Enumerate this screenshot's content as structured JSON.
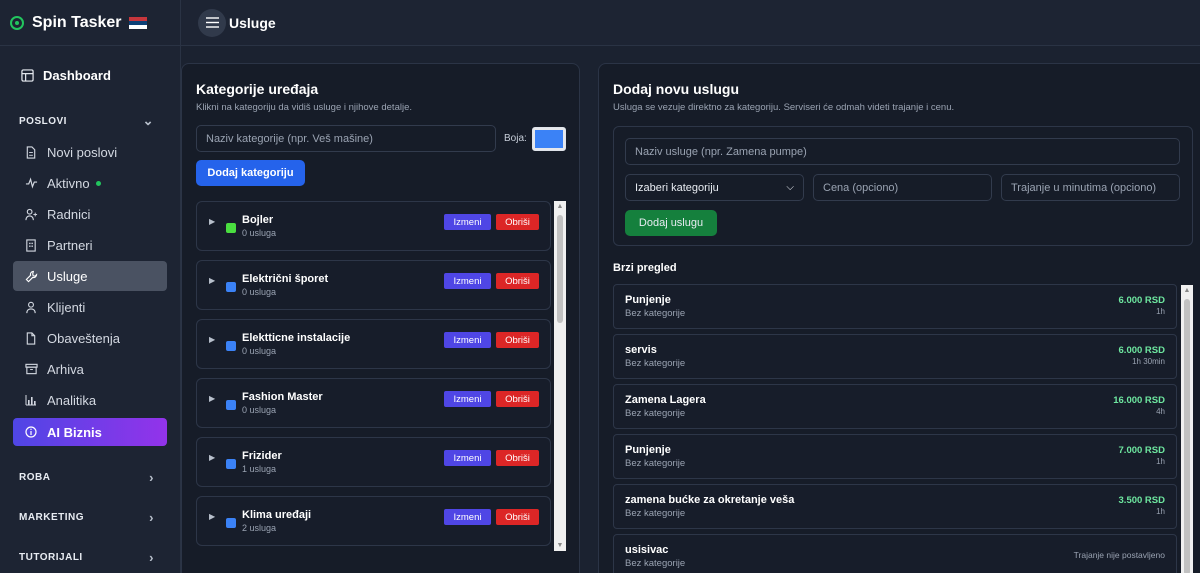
{
  "app": {
    "name": "Spin Tasker"
  },
  "topbar": {
    "title": "Usluge"
  },
  "sidebar": {
    "dashboard": "Dashboard",
    "sections": {
      "poslovi": "POSLOVI",
      "roba": "ROBA",
      "marketing": "MARKETING",
      "tutorijali": "TUTORIJALI"
    },
    "items": [
      {
        "label": "Novi poslovi",
        "icon": "document-icon"
      },
      {
        "label": "Aktivno",
        "icon": "activity-icon"
      },
      {
        "label": "Radnici",
        "icon": "user-plus-icon"
      },
      {
        "label": "Partneri",
        "icon": "building-icon"
      },
      {
        "label": "Usluge",
        "icon": "wrench-icon"
      },
      {
        "label": "Klijenti",
        "icon": "user-icon"
      },
      {
        "label": "Obaveštenja",
        "icon": "file-icon"
      },
      {
        "label": "Arhiva",
        "icon": "archive-icon"
      },
      {
        "label": "Analitika",
        "icon": "bar-chart-icon"
      }
    ],
    "ai": "AI Biznis"
  },
  "categories": {
    "title": "Kategorije uređaja",
    "subtitle": "Klikni na kategoriju da vidiš usluge i njihove detalje.",
    "input_placeholder": "Naziv kategorije (npr. Veš mašine)",
    "color_label": "Boja:",
    "color_value": "#3b82f6",
    "add_button": "Dodaj kategoriju",
    "edit_label": "Izmeni",
    "delete_label": "Obriši",
    "items": [
      {
        "name": "Bojler",
        "count": "0 usluga",
        "color": "#4ade40"
      },
      {
        "name": "Električni šporet",
        "count": "0 usluga",
        "color": "#3b82f6"
      },
      {
        "name": "Elektticne instalacije",
        "count": "0 usluga",
        "color": "#3b82f6"
      },
      {
        "name": "Fashion Master",
        "count": "0 usluga",
        "color": "#3b82f6"
      },
      {
        "name": "Frizider",
        "count": "1 usluga",
        "color": "#3b82f6"
      },
      {
        "name": "Klima uređaji",
        "count": "2 usluga",
        "color": "#3b82f6"
      }
    ]
  },
  "new_service": {
    "title": "Dodaj novu uslugu",
    "subtitle": "Usluga se vezuje direktno za kategoriju. Serviseri će odmah videti trajanje i cenu.",
    "name_placeholder": "Naziv usluge (npr. Zamena pumpe)",
    "category_select": "Izaberi kategoriju",
    "price_placeholder": "Cena (opciono)",
    "duration_placeholder": "Trajanje u minutima (opciono)",
    "add_button": "Dodaj uslugu"
  },
  "overview": {
    "title": "Brzi pregled",
    "items": [
      {
        "name": "Punjenje",
        "category": "Bez kategorije",
        "price": "6.000 RSD",
        "duration": "1h"
      },
      {
        "name": "servis",
        "category": "Bez kategorije",
        "price": "6.000 RSD",
        "duration": "1h 30min"
      },
      {
        "name": "Zamena Lagera",
        "category": "Bez kategorije",
        "price": "16.000 RSD",
        "duration": "4h"
      },
      {
        "name": "Punjenje",
        "category": "Bez kategorije",
        "price": "7.000 RSD",
        "duration": "1h"
      },
      {
        "name": "zamena bućke za okretanje veša",
        "category": "Bez kategorije",
        "price": "3.500 RSD",
        "duration": "1h"
      },
      {
        "name": "usisivac",
        "category": "Bez kategorije",
        "price": "",
        "duration": "Trajanje nije postavljeno"
      }
    ]
  }
}
